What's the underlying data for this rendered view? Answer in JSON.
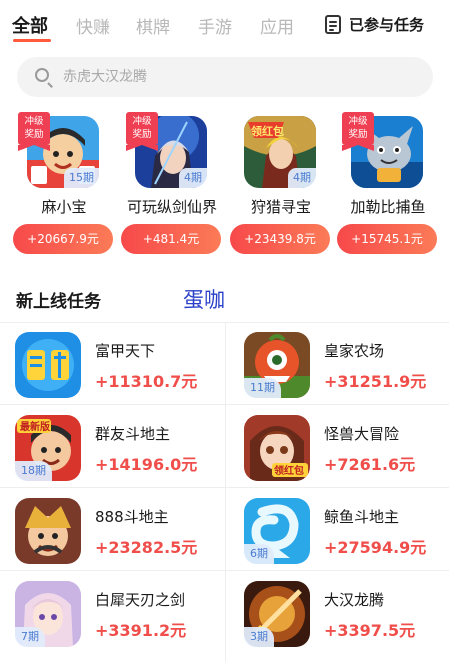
{
  "tabs": [
    "全部",
    "快赚",
    "棋牌",
    "手游",
    "应用"
  ],
  "my_tasks_label": "已参与任务",
  "search": {
    "placeholder": "赤虎大汉龙腾"
  },
  "reward_tag_line1": "冲级",
  "reward_tag_line2": "奖励",
  "featured": [
    {
      "name": "麻小宝",
      "period": "15期",
      "amount": "+20667.9元",
      "reward": true,
      "icon": "majong-character-icon"
    },
    {
      "name": "可玩纵剑仙界",
      "period": "4期",
      "amount": "+481.4元",
      "reward": true,
      "icon": "swordsman-icon"
    },
    {
      "name": "狩猎寻宝",
      "period": "4期",
      "amount": "+23439.8元",
      "reward": false,
      "badge": "领红包",
      "icon": "hunter-icon"
    },
    {
      "name": "加勒比捕鱼",
      "period": "",
      "amount": "+15745.1元",
      "reward": true,
      "icon": "fishing-cat-icon"
    }
  ],
  "section_title": "新上线任务",
  "watermark": "蛋咖",
  "tasks": [
    {
      "name": "富甲天下",
      "period": "",
      "amount": "+11310.7元",
      "icon": "fujia-icon"
    },
    {
      "name": "皇家农场",
      "period": "11期",
      "amount": "+31251.9元",
      "icon": "farm-monster-icon"
    },
    {
      "name": "群友斗地主",
      "period": "18期",
      "amount": "+14196.0元",
      "icon": "landlord-new-icon",
      "badge": "最新版"
    },
    {
      "name": "怪兽大冒险",
      "period": "",
      "amount": "+7261.6元",
      "icon": "monster-girl-icon",
      "badge": "领红包"
    },
    {
      "name": "888斗地主",
      "period": "",
      "amount": "+23282.5元",
      "icon": "landlord-888-icon"
    },
    {
      "name": "鲸鱼斗地主",
      "period": "6期",
      "amount": "+27594.9元",
      "icon": "whale-icon"
    },
    {
      "name": "白犀天刃之剑",
      "period": "7期",
      "amount": "+3391.2元",
      "icon": "anime-girl-icon"
    },
    {
      "name": "大汉龙腾",
      "period": "3期",
      "amount": "+3397.5元",
      "icon": "dragon-sword-icon"
    }
  ],
  "colors": {
    "accent": "#ff5a3c",
    "amount": "#f04e4a",
    "reward_tag": "#ef3f53",
    "period_text": "#4a7bd0"
  }
}
